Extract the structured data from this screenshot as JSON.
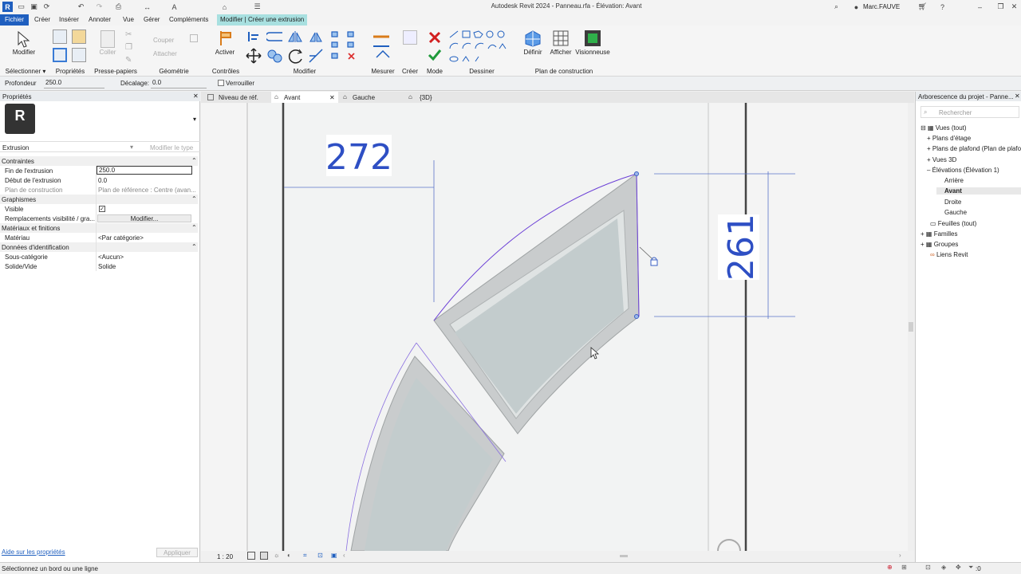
{
  "window": {
    "title": "Autodesk Revit 2024 - Panneau.rfa - Élévation: Avant",
    "user": "Marc.FAUVE"
  },
  "menu": {
    "items": [
      "Fichier",
      "Créer",
      "Insérer",
      "Annoter",
      "Vue",
      "Gérer",
      "Compléments",
      "Modifier | Créer une extrusion"
    ]
  },
  "ribbon": {
    "modify_label": "Modifier",
    "panels": {
      "select": "Sélectionner ▾",
      "properties": "Propriétés",
      "clipboard": "Presse-papiers",
      "geometry": "Géométrie",
      "controls": "Contrôles",
      "modify": "Modifier",
      "measure": "Mesurer",
      "create": "Créer",
      "mode": "Mode",
      "draw": "Dessiner",
      "workplane": "Plan de construction"
    },
    "clipboard_items": {
      "paste": "Coller",
      "cut": "Couper",
      "join": "Attacher"
    },
    "activate_label": "Activer",
    "workplane_buttons": {
      "define": "Définir",
      "show": "Afficher",
      "viewer": "Visionneuse"
    }
  },
  "options_bar": {
    "depth_label": "Profondeur",
    "depth_value": "250.0",
    "offset_label": "Décalage:",
    "offset_value": "0.0",
    "lock_label": "Verrouiller"
  },
  "properties_panel": {
    "title": "Propriétés",
    "type_name": "Extrusion",
    "edit_type": "Modifier le type",
    "groups": [
      {
        "name": "Contraintes",
        "rows": [
          {
            "key": "Fin de l'extrusion",
            "value": "250.0"
          },
          {
            "key": "Début de l'extrusion",
            "value": "0.0"
          },
          {
            "key": "Plan de construction",
            "value": "Plan de référence : Centre (avan..."
          }
        ]
      },
      {
        "name": "Graphismes",
        "rows": [
          {
            "key": "Visible",
            "value": ""
          },
          {
            "key": "Remplacements visibilité / gra...",
            "value": "Modifier..."
          }
        ]
      },
      {
        "name": "Matériaux et finitions",
        "rows": [
          {
            "key": "Matériau",
            "value": "<Par catégorie>"
          }
        ]
      },
      {
        "name": "Données d'identification",
        "rows": [
          {
            "key": "Sous-catégorie",
            "value": "<Aucun>"
          },
          {
            "key": "Solide/Vide",
            "value": "Solide"
          }
        ]
      }
    ],
    "help_link": "Aide sur les propriétés",
    "apply_button": "Appliquer"
  },
  "view_tabs": [
    "Niveau de réf.",
    "Avant",
    "Gauche",
    "{3D}"
  ],
  "canvas": {
    "dim_horizontal": "272",
    "dim_vertical": "261"
  },
  "view_bar": {
    "scale": "1 : 20"
  },
  "project_browser": {
    "title": "Arborescence du projet - Panne...",
    "search_placeholder": "Rechercher",
    "nodes": [
      {
        "label": "Vues (tout)"
      },
      {
        "label": "Plans d'étage"
      },
      {
        "label": "Plans de plafond (Plan de plafond)"
      },
      {
        "label": "Vues 3D"
      },
      {
        "label": "Élévations (Élévation 1)"
      },
      {
        "label": "Arrière"
      },
      {
        "label": "Avant"
      },
      {
        "label": "Droite"
      },
      {
        "label": "Gauche"
      },
      {
        "label": "Feuilles (tout)"
      },
      {
        "label": "Familles"
      },
      {
        "label": "Groupes"
      },
      {
        "label": "Liens Revit"
      }
    ]
  },
  "status": {
    "message": "Sélectionnez un bord ou une ligne",
    "filter_count": ":0"
  }
}
